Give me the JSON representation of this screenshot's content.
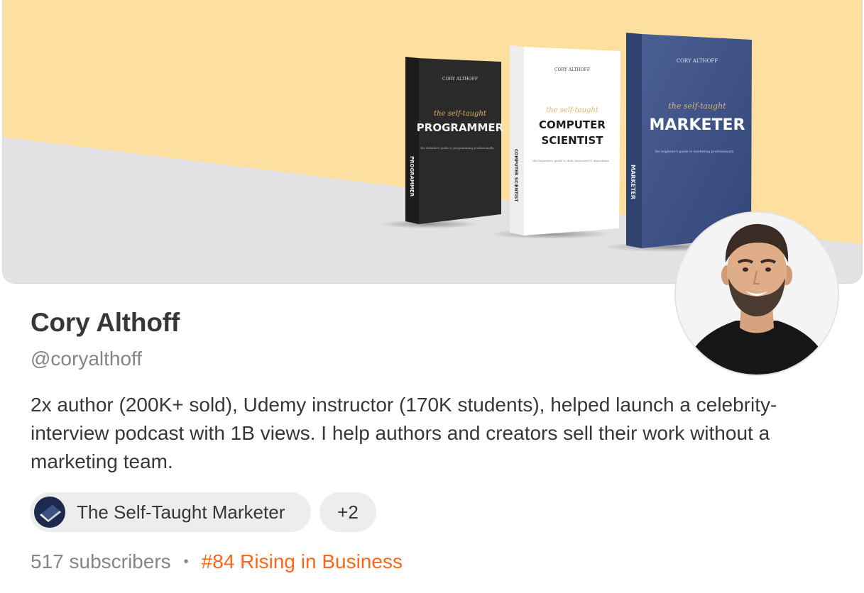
{
  "banner": {
    "books": [
      {
        "author": "CORY ALTHOFF",
        "series": "the self-taught",
        "title_lines": [
          "PROGRAMMER"
        ],
        "subtitle": "the definitive guide to programming professionally",
        "spine": "PROGRAMMER"
      },
      {
        "author": "CORY ALTHOFF",
        "series": "the self-taught",
        "title_lines": [
          "COMPUTER",
          "SCIENTIST"
        ],
        "subtitle": "the beginner's guide to data structures & algorithms",
        "spine": "COMPUTER SCIENTIST"
      },
      {
        "author": "CORY ALTHOFF",
        "series": "the self-taught",
        "title_lines": [
          "MARKETER"
        ],
        "subtitle": "the beginner's guide to marketing professionally",
        "spine": "MARKETER"
      }
    ]
  },
  "profile": {
    "name": "Cory Althoff",
    "handle": "@coryalthoff",
    "bio": "2x author (200K+ sold), Udemy instructor (170K students), helped launch a celebrity-interview podcast with 1B views. I help authors and creators sell their work without a marketing team."
  },
  "publications": {
    "primary": "The Self-Taught Marketer",
    "more": "+2"
  },
  "stats": {
    "subscribers": "517 subscribers",
    "separator": "•",
    "rank": "#84 Rising in Business"
  },
  "colors": {
    "accent": "#ff6719",
    "banner_yellow": "#fde0a0",
    "banner_gray": "#e3e1e3",
    "marketer_blue": "#3c5183"
  },
  "icons": {
    "avatar": "person-avatar",
    "publication_logo": "book-logo-icon"
  }
}
